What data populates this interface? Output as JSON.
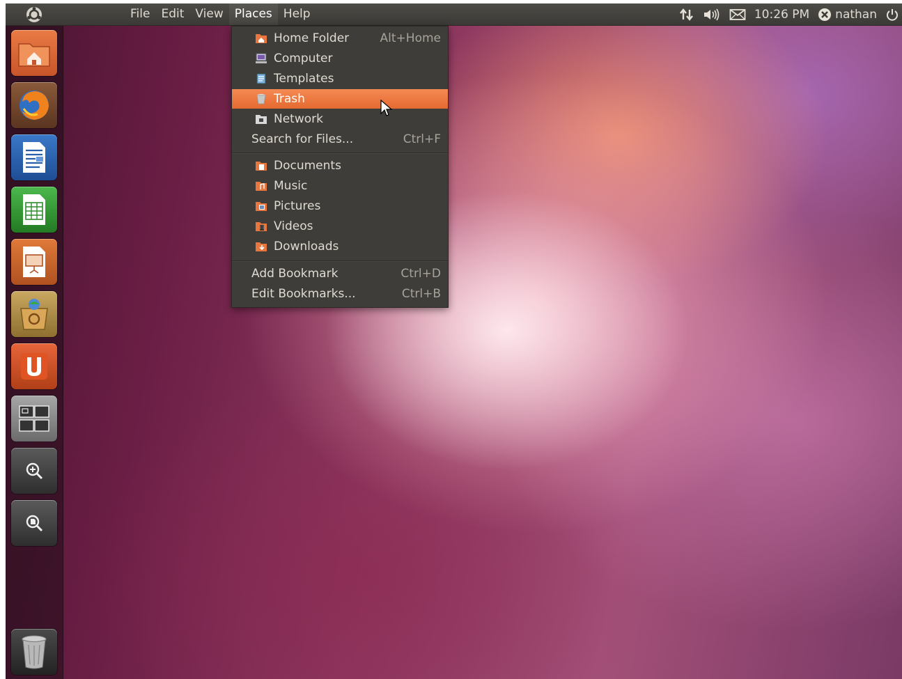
{
  "top_panel": {
    "menus": [
      "File",
      "Edit",
      "View",
      "Places",
      "Help"
    ],
    "active_menu": "Places",
    "clock": "10:26 PM",
    "user": "nathan"
  },
  "places_menu": {
    "items": [
      {
        "label": "Home Folder",
        "shortcut": "Alt+Home",
        "icon": "home-folder-icon"
      },
      {
        "label": "Computer",
        "shortcut": "",
        "icon": "computer-icon"
      },
      {
        "label": "Templates",
        "shortcut": "",
        "icon": "templates-icon"
      },
      {
        "label": "Trash",
        "shortcut": "",
        "icon": "trash-icon"
      },
      {
        "label": "Network",
        "shortcut": "",
        "icon": "network-icon"
      },
      {
        "label": "Search for Files...",
        "shortcut": "Ctrl+F",
        "icon": ""
      }
    ],
    "bookmarks": [
      {
        "label": "Documents",
        "icon": "documents-folder-icon"
      },
      {
        "label": "Music",
        "icon": "music-folder-icon"
      },
      {
        "label": "Pictures",
        "icon": "pictures-folder-icon"
      },
      {
        "label": "Videos",
        "icon": "videos-folder-icon"
      },
      {
        "label": "Downloads",
        "icon": "downloads-folder-icon"
      }
    ],
    "actions": [
      {
        "label": "Add Bookmark",
        "shortcut": "Ctrl+D"
      },
      {
        "label": "Edit Bookmarks...",
        "shortcut": "Ctrl+B"
      }
    ],
    "highlighted": "Trash"
  },
  "launcher": {
    "items": [
      "home-folder",
      "firefox",
      "writer",
      "calc",
      "impress",
      "software-center",
      "ubuntu-one",
      "workspaces",
      "search-apps",
      "search-files",
      "trash"
    ]
  },
  "colors": {
    "panel": "#3b3a36",
    "menu_bg": "#3f3d39",
    "highlight": "#e46a30"
  }
}
